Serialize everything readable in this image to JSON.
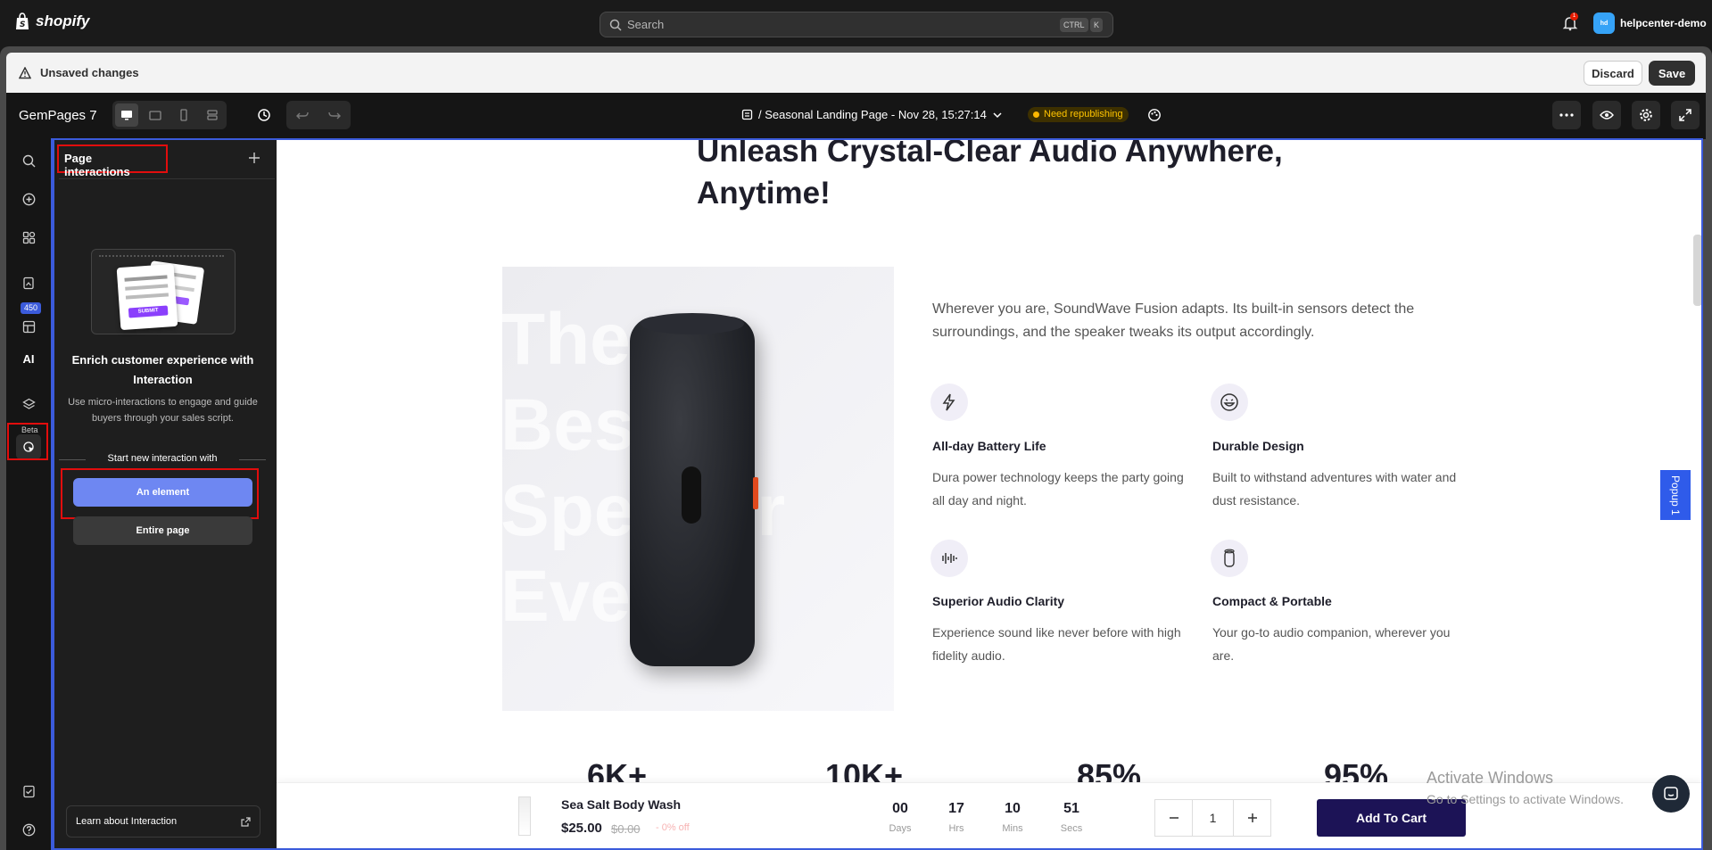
{
  "shopify": {
    "logo_text": "shopify",
    "search_placeholder": "Search",
    "shortcut_ctrl": "CTRL",
    "shortcut_key": "K",
    "notification_count": "1",
    "store_initials": "hd",
    "store_name": "helpcenter-demo"
  },
  "unsaved": {
    "message": "Unsaved changes",
    "discard_label": "Discard",
    "save_label": "Save"
  },
  "editor": {
    "app_name": "GemPages 7",
    "page_name": "/ Seasonal Landing Page - Nov 28, 15:27:14",
    "status_badge": "Need republishing",
    "rail_badge": "450",
    "ai_label": "AI",
    "beta_label": "Beta"
  },
  "panel": {
    "title": "Page interactions",
    "illus_button": "SUBMIT",
    "heading": "Enrich customer experience with Interaction",
    "description": "Use micro-interactions to engage and guide buyers through your sales script.",
    "start_with": "Start new interaction with",
    "btn_element": "An element",
    "btn_page": "Entire page",
    "learn_link": "Learn about Interaction"
  },
  "page": {
    "heading": "Unleash Crystal-Clear Audio Anywhere, Anytime!",
    "bg_words": [
      "The",
      "Best",
      "Speaker",
      "Ever"
    ],
    "intro": "Wherever you are, SoundWave Fusion adapts. Its built-in sensors detect the surroundings, and the speaker tweaks its output accordingly.",
    "features": [
      {
        "icon": "lightning-icon",
        "title": "All-day Battery Life",
        "desc": "Dura power technology keeps the party going all day and night."
      },
      {
        "icon": "smile-icon",
        "title": "Durable Design",
        "desc": "Built to withstand adventures with water and dust resistance."
      },
      {
        "icon": "soundwave-icon",
        "title": "Superior Audio Clarity",
        "desc": "Experience sound like never before with high fidelity audio."
      },
      {
        "icon": "speaker-icon",
        "title": "Compact & Portable",
        "desc": "Your go-to audio companion, wherever you are."
      }
    ],
    "stats": [
      "6K+",
      "10K+",
      "85%",
      "95%"
    ],
    "popup_tab": "Popup 1"
  },
  "sticky_bar": {
    "product_name": "Sea Salt Body Wash",
    "price": "$25.00",
    "compare_price": "$0.00",
    "discount": "- 0% off",
    "countdown": [
      {
        "value": "00",
        "label": "Days"
      },
      {
        "value": "17",
        "label": "Hrs"
      },
      {
        "value": "10",
        "label": "Mins"
      },
      {
        "value": "51",
        "label": "Secs"
      }
    ],
    "quantity": "1",
    "add_to_cart": "Add To Cart"
  },
  "windows_notice": {
    "title": "Activate Windows",
    "subtitle": "Go to Settings to activate Windows."
  },
  "colors": {
    "accent": "#6e87f2",
    "selection": "#3b5bdb",
    "highlight": "#e20d0d",
    "cart_button": "#1c1356"
  }
}
